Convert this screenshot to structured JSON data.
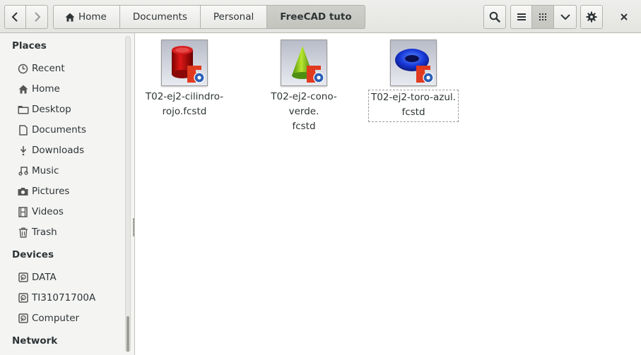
{
  "toolbar": {
    "back_icon": "chevron-left-icon",
    "forward_icon": "chevron-right-icon",
    "breadcrumbs": [
      "Home",
      "Documents",
      "Personal",
      "FreeCAD tuto"
    ],
    "search_icon": "search-icon",
    "list_view_icon": "list-view-icon",
    "grid_view_icon": "grid-view-icon",
    "view_options_icon": "chevron-down-icon",
    "settings_icon": "gear-icon",
    "close_icon": "close-icon"
  },
  "sidebar": {
    "places_header": "Places",
    "places": [
      {
        "label": "Recent",
        "icon": "clock-icon"
      },
      {
        "label": "Home",
        "icon": "home-icon"
      },
      {
        "label": "Desktop",
        "icon": "folder-icon"
      },
      {
        "label": "Documents",
        "icon": "document-icon"
      },
      {
        "label": "Downloads",
        "icon": "download-icon"
      },
      {
        "label": "Music",
        "icon": "music-icon"
      },
      {
        "label": "Pictures",
        "icon": "camera-icon"
      },
      {
        "label": "Videos",
        "icon": "film-icon"
      },
      {
        "label": "Trash",
        "icon": "trash-icon"
      }
    ],
    "devices_header": "Devices",
    "devices": [
      {
        "label": "DATA",
        "icon": "drive-icon"
      },
      {
        "label": "TI31071700A",
        "icon": "drive-icon"
      },
      {
        "label": "Computer",
        "icon": "drive-icon"
      }
    ],
    "network_header": "Network"
  },
  "files": [
    {
      "line1": "T02-ej2-cilindro-",
      "line2": "rojo.fcstd",
      "thumbnail": "red-cylinder",
      "badge": "freecad-icon"
    },
    {
      "line1": "T02-ej2-cono-verde.",
      "line2": "fcstd",
      "thumbnail": "green-cone",
      "badge": "freecad-icon"
    },
    {
      "line1": "T02-ej2-toro-azul.",
      "line2": "fcstd",
      "thumbnail": "blue-torus",
      "badge": "freecad-icon"
    }
  ],
  "colors": {
    "accent_crumb": "#c8c8c4",
    "freecad_red": "#e03a1f",
    "gear_blue": "#2b5fb4"
  }
}
